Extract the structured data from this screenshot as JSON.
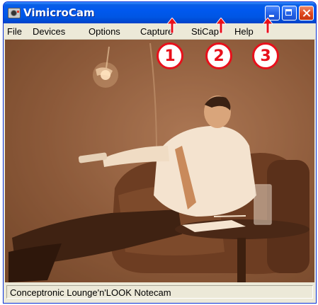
{
  "window": {
    "title": "VimicroCam"
  },
  "menu": {
    "file": "File",
    "devices": "Devices",
    "options": "Options",
    "capture": "Capture",
    "sticap": "StiCap",
    "help": "Help"
  },
  "annotations": {
    "one": "1",
    "two": "2",
    "three": "3"
  },
  "status": {
    "text": "Conceptronic Lounge'n'LOOK Notecam"
  },
  "colors": {
    "titlebar": "#0058ee",
    "callout": "#e8101b",
    "sepia": "#8b5939"
  }
}
